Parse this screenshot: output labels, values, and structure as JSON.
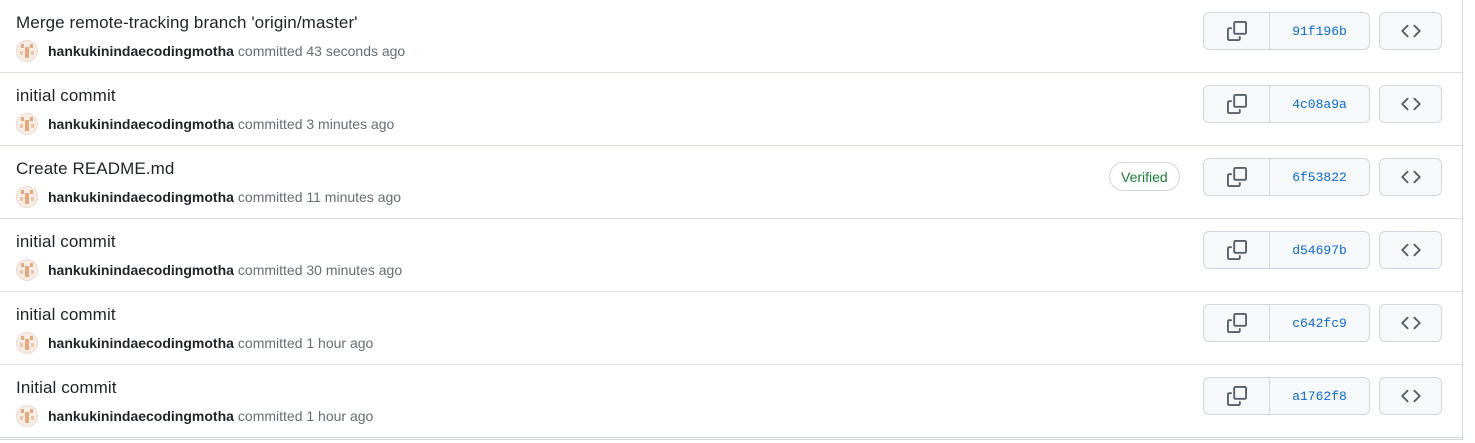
{
  "commits": [
    {
      "title": "Merge remote-tracking branch 'origin/master'",
      "author": "hankukinindaecodingmotha",
      "committed_text": "committed 43 seconds ago",
      "sha": "91f196b",
      "verified": ""
    },
    {
      "title": "initial commit",
      "author": "hankukinindaecodingmotha",
      "committed_text": "committed 3 minutes ago",
      "sha": "4c08a9a",
      "verified": ""
    },
    {
      "title": "Create README.md",
      "author": "hankukinindaecodingmotha",
      "committed_text": "committed 11 minutes ago",
      "sha": "6f53822",
      "verified": "Verified"
    },
    {
      "title": "initial commit",
      "author": "hankukinindaecodingmotha",
      "committed_text": "committed 30 minutes ago",
      "sha": "d54697b",
      "verified": ""
    },
    {
      "title": "initial commit",
      "author": "hankukinindaecodingmotha",
      "committed_text": "committed 1 hour ago",
      "sha": "c642fc9",
      "verified": ""
    },
    {
      "title": "Initial commit",
      "author": "hankukinindaecodingmotha",
      "committed_text": "committed 1 hour ago",
      "sha": "a1762f8",
      "verified": ""
    }
  ],
  "icons": {
    "copy": "copy-icon",
    "browse": "code-icon",
    "avatar": "identicon-avatar"
  },
  "colors": {
    "sha_link": "#0969da",
    "verified_green": "#1a7f37",
    "avatar_orange": "#e8a87c"
  }
}
